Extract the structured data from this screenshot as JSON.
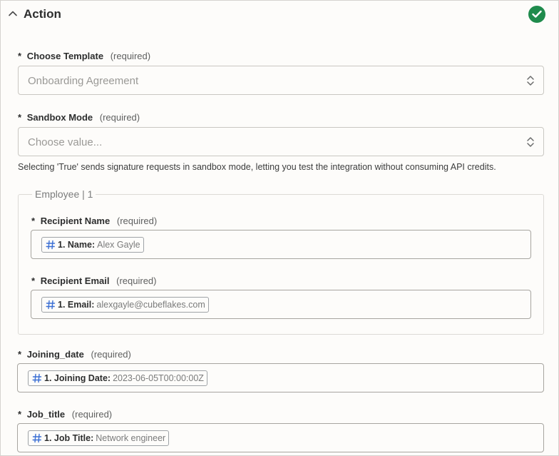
{
  "section": {
    "title": "Action",
    "status_color": "#1f8b4c"
  },
  "template": {
    "label": "Choose Template",
    "required": "(required)",
    "value": "Onboarding Agreement"
  },
  "sandbox": {
    "label": "Sandbox Mode",
    "required": "(required)",
    "placeholder": "Choose value...",
    "help": "Selecting 'True' sends signature requests in sandbox mode, letting you test the integration without consuming API credits."
  },
  "employee_group": {
    "legend": "Employee | 1",
    "recipient_name": {
      "label": "Recipient Name",
      "required": "(required)",
      "chip_key": "1. Name:",
      "chip_value": "Alex Gayle"
    },
    "recipient_email": {
      "label": "Recipient Email",
      "required": "(required)",
      "chip_key": "1. Email:",
      "chip_value": "alexgayle@cubeflakes.com"
    }
  },
  "joining_date": {
    "label": "Joining_date",
    "required": "(required)",
    "chip_key": "1. Joining Date:",
    "chip_value": "2023-06-05T00:00:00Z"
  },
  "job_title": {
    "label": "Job_title",
    "required": "(required)",
    "chip_key": "1. Job Title:",
    "chip_value": "Network engineer"
  },
  "required_marker": "*",
  "colors": {
    "accent": "#1f8b4c",
    "chip_icon": "#3b6fd4"
  }
}
